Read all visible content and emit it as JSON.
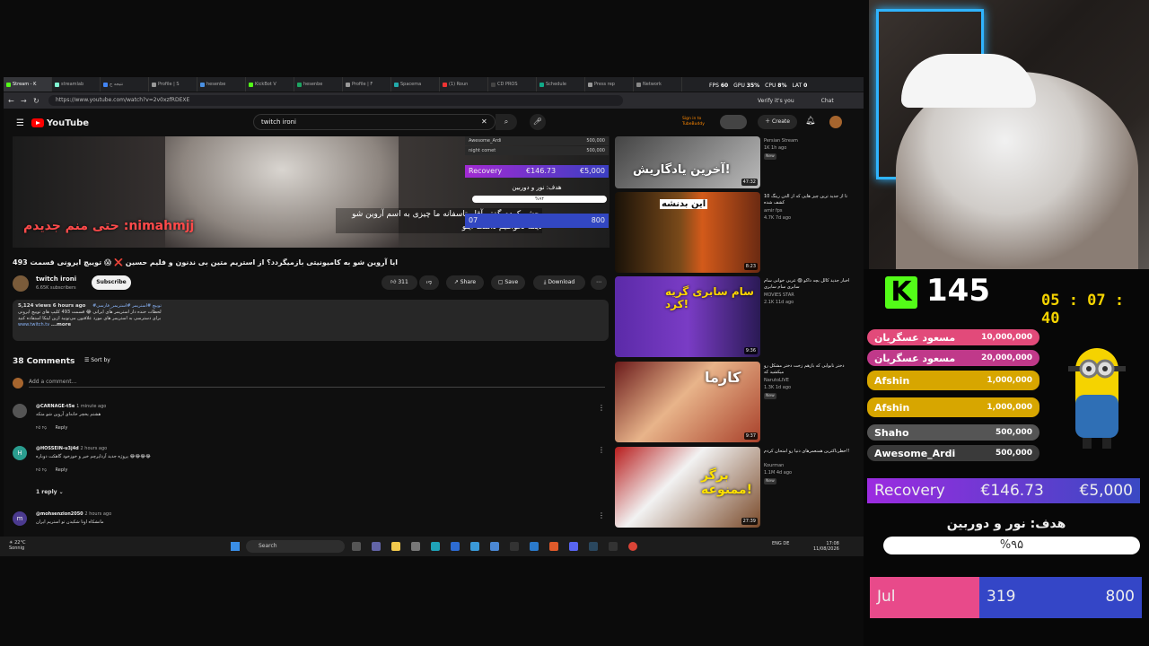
{
  "browser": {
    "tabs": [
      "Stream - K",
      "streamlab",
      "نتیجه ج",
      "Profile | S",
      "hesenbe",
      "KickBot V",
      "hesenbe",
      "Profile | F",
      "Spacema",
      "(1) Roun",
      "CD PROS",
      "Schedule",
      "Press rep",
      "Network"
    ],
    "url": "https://www.youtube.com/watch?v=2v0xzfRDEXE",
    "profile_label": "Verify it's you",
    "chat_label": "Chat"
  },
  "youtube": {
    "logo": "YouTube",
    "search_value": "twitch ironi",
    "sign_in": "Sign in to TubeBuddy",
    "create_label": "Create",
    "video_title": "ایا آروین شو به کامیونیتی بازمیگردد؟ از استریم متین بی ندنون و فلیم حسین ❌ 😱 توییچ ایرونی قسمت 493",
    "channel_name": "twitch ironi",
    "subscribers": "6.65K subscribers",
    "subscribe_label": "Subscribe",
    "likes": "311",
    "share_label": "Share",
    "save_label": "Save",
    "download_label": "Download",
    "desc_stats": "5,124 views  6 hours ago",
    "desc_tags": "#توییچ #استریمر #استریمر_فارسی",
    "desc_line1": "لحظات خنده دار استریمر های ایرانی 😂 قسمت 493 کلیپ های توییچ ایرونی",
    "desc_line2": "برای دسترسی به استریمر های مورد علاقتون می‌تونید ازین لینکا استفاده کنید",
    "desc_link": "www.twitch.tv",
    "desc_more": "...more",
    "comments_count": "38 Comments",
    "sort_by": "Sort by",
    "add_comment": "Add a comment...",
    "comments": [
      {
        "user": "@CARNAGE-t5e",
        "time": "1 minute ago",
        "text": "هشتم یخچر خانه‌ای آروین شو متکه",
        "reply": "Reply"
      },
      {
        "user": "@HOSSEIN-u3j4d",
        "time": "2 hours ago",
        "text": "پروژه جدید آرداپرچم خیر و خوزخود گاهکت دوباره 😂😂😂😂",
        "reply": "Reply",
        "replies": "1 reply"
      },
      {
        "user": "@mohsenzion2050",
        "time": "2 hours ago",
        "text": "مانشکاه اونا شکیدن تو استریم ایران"
      }
    ],
    "suggestions": [
      {
        "title": "",
        "channel": "Persian Stream",
        "meta": "1K  1h ago",
        "badge": "New",
        "dur": "47:32",
        "thumb_text": "آخرین یادگاریش!"
      },
      {
        "title": "10 تا از جدید ترین چیز هایی که از الدن رینگ کشف شده",
        "channel": "amir fps",
        "meta": "4.7K  7d ago",
        "badge": "",
        "dur": "8:23",
        "thumb_text": "این بدنشه"
      },
      {
        "title": "اخبار جدید کالل بچه داکو 😱 عربی خوانی سام سابری سام سابری",
        "channel": "MOVIES STAR",
        "meta": "2.1K  11d ago",
        "badge": "",
        "dur": "9:36",
        "thumb_text": "سام سابری گریه کرد!"
      },
      {
        "title": "دختر نابوابی که بازهم زخت دختر مشکل رو میکشید که",
        "channel": "NarutoLIVE",
        "meta": "1.3K  1d ago",
        "badge": "New",
        "dur": "9:37",
        "thumb_text": "کارما"
      },
      {
        "title": "خطرناکترین همنعمرهای دنیا رو امتحان کردم!!",
        "channel": "Kourman",
        "meta": "1.1M  4d ago",
        "badge": "New",
        "dur": "27:39",
        "thumb_text": "برگر ممنوعه!"
      }
    ]
  },
  "video_overlay": {
    "donor1": "Awesome_Ardi",
    "donor1_val": "500,000",
    "donor2": "night comet",
    "donor2_val": "500,000",
    "recovery_label": "Recovery",
    "recovery_cur": "€146.73",
    "recovery_goal": "€5,000",
    "goal_title": "هدف: نور و دوربین",
    "goal_pct": "%۹۴",
    "bar_left": "07",
    "bar_right": "800",
    "caption_chat": "حتی منم جدیدم :nimahmjj",
    "caption_sub": "بحشو کردم گفتم آقا متاسفانه ما چیزی به اسم آروین شو دیگه نخواهیم داشت اینو"
  },
  "taskbar": {
    "weather_temp": "22°C",
    "weather_desc": "Sonnig",
    "search": "Search",
    "lang": "ENG DE",
    "time": "17:08",
    "date": "11/08/2026"
  },
  "perf": {
    "fps_label": "FPS",
    "fps": "60",
    "gpu_label": "GPU",
    "gpu": "35%",
    "cpu_label": "CPU",
    "cpu": "8%",
    "lat_label": "LAT",
    "lat": "0"
  },
  "stream_panel": {
    "k_logo": "K",
    "viewer_count": "145",
    "timer": "05 : 07 : 40",
    "donors": [
      {
        "name": "مسعود عسگریان",
        "amount": "10,000,000",
        "color": "#e24a7a"
      },
      {
        "name": "مسعود عسگریان",
        "amount": "20,000,000",
        "color": "#c0398a"
      },
      {
        "name": "Afshin",
        "amount": "1,000,000",
        "color": "#d7a600"
      },
      {
        "name": "Afshin",
        "amount": "1,000,000",
        "color": "#d7a600"
      },
      {
        "name": "Shaho",
        "amount": "500,000",
        "color": "#555555"
      },
      {
        "name": "Awesome_Ardi",
        "amount": "500,000",
        "color": "#3a3a3a"
      }
    ],
    "recovery_label": "Recovery",
    "recovery_current": "€146.73",
    "recovery_goal": "€5,000",
    "goal_title": "هدف: نور و دوربین",
    "goal_percent": "%۹۵",
    "month_label": "Jul",
    "month_current": "319",
    "month_target": "800"
  },
  "colors": {
    "accent_kick": "#53fc18",
    "timer": "#f5d300",
    "yt_red": "#ff0000"
  }
}
